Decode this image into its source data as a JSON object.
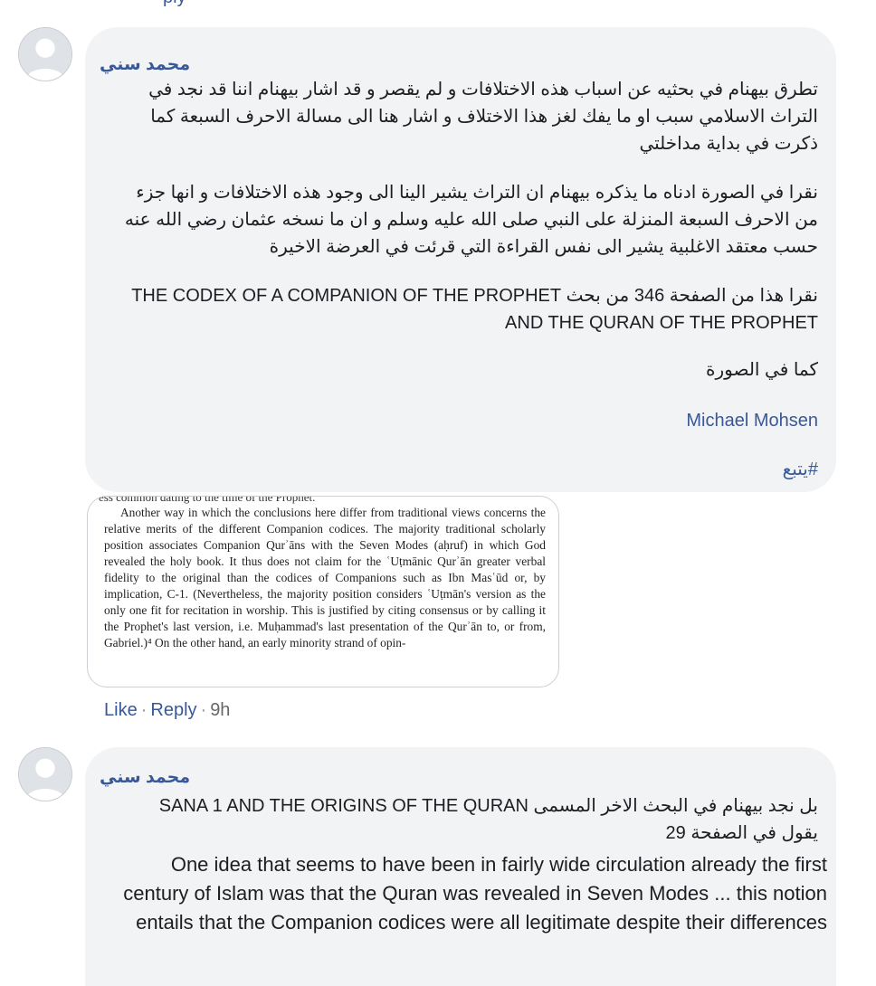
{
  "top_fragment": "ply",
  "comments": [
    {
      "author": "محمد سني",
      "paragraphs": [
        "تطرق بيهنام في بحثيه عن اسباب هذه الاختلافات و لم يقصر و قد اشار بيهنام اننا قد نجد في التراث الاسلامي سبب او ما يفك لغز هذا الاختلاف و اشار هنا الى مسالة الاحرف السبعة كما ذكرت في بداية مداخلتي",
        "نقرا في الصورة ادناه ما يذكره بيهنام ان التراث يشير الينا الى وجود هذه الاختلافات و انها جزء من الاحرف السبعة المنزلة على النبي صلى الله عليه وسلم و ان ما نسخه عثمان رضي الله عنه حسب معتقد الاغلبية يشير الى نفس القراءة التي قرئت في العرضة الاخيرة",
        "نقرا هذا من الصفحة 346 من بحث THE CODEX OF A COMPANION OF THE PROPHET AND THE QURAN OF THE PROPHET",
        "كما في الصورة"
      ],
      "mention": "Michael Mohsen",
      "hashtag": "#يتبع"
    },
    {
      "author": "محمد سني",
      "paragraphs": [
        "بل نجد بيهنام في البحث الاخر المسمى SANA 1 AND THE ORIGINS OF THE QURAN يقول في الصفحة 29",
        "One idea that seems to have been in fairly wide circulation already the first century of Islam was that the Quran was revealed in Seven Modes ... this notion entails that the Companion codices were all legitimate despite their differences"
      ]
    }
  ],
  "inset_image": {
    "cut_line": "ess common dating to the time of the Prophet.",
    "text": "Another way in which the conclusions here differ from traditional views concerns the relative merits of the different Companion codices. The majority traditional scholarly position associates Companion Qurʾāns with the Seven Modes (aḥruf) in which God revealed the holy book. It thus does not claim for the ʿUṭmānic Qurʾān greater verbal fidelity to the original than the codices of Companions such as Ibn Masʿūd or, by implication, C-1. (Nevertheless, the majority position considers ʿUṭmān's version as the only one fit for recitation in worship. This is justified by citing consensus or by calling it the Prophet's last version, i.e. Muḥammad's last presentation of the Qurʾān to, or from, Gabriel.)⁴ On the other hand, an early minority strand of opin-"
  },
  "actions": {
    "like": "Like",
    "reply": "Reply",
    "separator": "·",
    "time": "9h"
  },
  "colors": {
    "link": "#385898",
    "bubble": "#f2f3f5",
    "avatar": "#dfe2e6"
  }
}
